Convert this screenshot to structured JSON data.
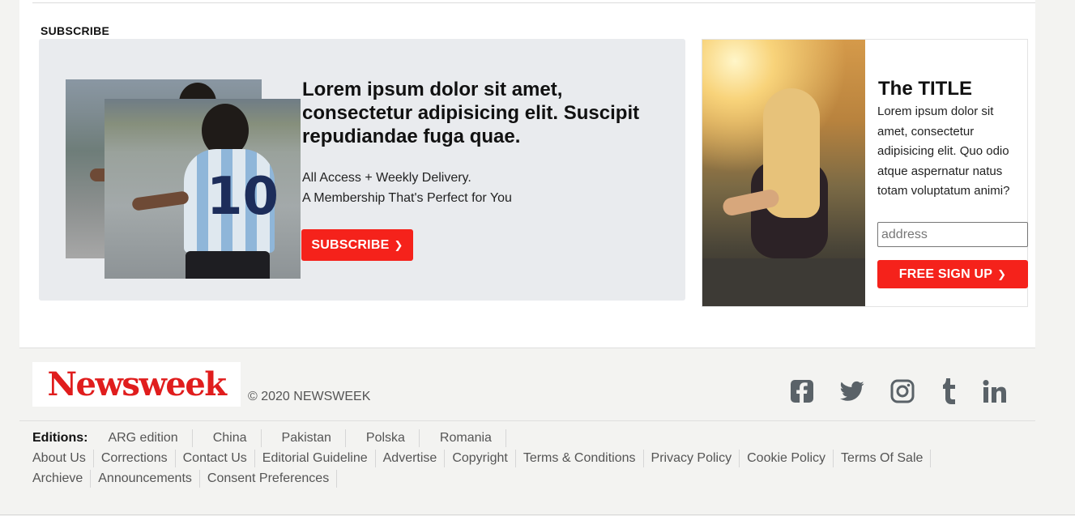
{
  "subscribe_section": {
    "heading": "SUBSCRIBE",
    "promo": {
      "headline": "Lorem ipsum dolor sit amet, consectetur adipisicing elit. Suscipit repudiandae fuga quae.",
      "line1": "All Access + Weekly Delivery.",
      "line2": "A Membership That's Perfect for You",
      "button_label": "SUBSCRIBE",
      "player_number": "10"
    },
    "side": {
      "title": "The TITLE",
      "text": "Lorem ipsum dolor sit amet, consectetur adipisicing elit. Quo odio atque aspernatur natus totam voluptatum animi?",
      "input_placeholder": "address",
      "button_label": "FREE SIGN UP"
    }
  },
  "footer": {
    "logo_text": "Newsweek",
    "copyright": "© 2020 NEWSWEEK",
    "social": [
      "facebook-icon",
      "twitter-icon",
      "instagram-icon",
      "tumblr-icon",
      "linkedin-icon"
    ],
    "editions_label": "Editions:",
    "editions": [
      "ARG edition",
      "China",
      "Pakistan",
      "Polska",
      "Romania"
    ],
    "links_row1": [
      "About Us",
      "Corrections",
      "Contact Us",
      "Editorial Guideline",
      "Advertise",
      "Copyright",
      "Terms & Conditions",
      "Privacy Policy",
      "Cookie Policy",
      "Terms Of Sale"
    ],
    "links_row2": [
      "Archieve",
      "Announcements",
      "Consent Preferences"
    ]
  },
  "colors": {
    "accent_red": "#f5221b",
    "logo_red": "#e01d1d",
    "footer_bg": "#f3f3f1",
    "promo_bg": "#e9ebee"
  }
}
